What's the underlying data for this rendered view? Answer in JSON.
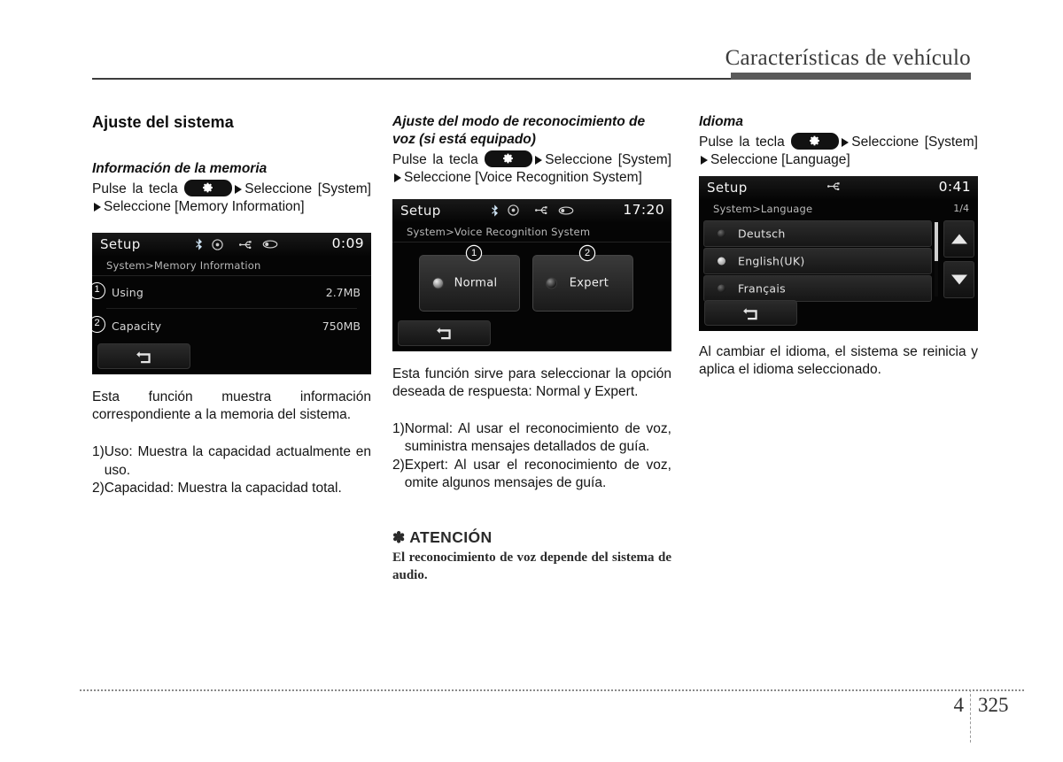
{
  "header": {
    "title": "Características de vehículo"
  },
  "footer": {
    "chapter": "4",
    "page": "325"
  },
  "column1": {
    "section_title": "Ajuste del sistema",
    "sub_title": "Información de la memoria",
    "instruction_pre": "Pulse la tecla",
    "instruction_post": "Seleccione [System]",
    "instruction_post2": "Seleccione [Memory Information]",
    "screen": {
      "title": "Setup",
      "clock": "0:09",
      "breadcrumb": "System>Memory Information",
      "status_icons": [
        "bluetooth-icon",
        "disc-icon",
        "usb-icon",
        "ipod-icon"
      ],
      "rows": [
        {
          "callout": "1",
          "label": "Using",
          "value": "2.7MB"
        },
        {
          "callout": "2",
          "label": "Capacity",
          "value": "750MB"
        }
      ],
      "back_button": "back-icon"
    },
    "description": "Esta función muestra información correspondiente a la memoria del sistema.",
    "list": [
      {
        "marker": "1)",
        "text": "Uso: Muestra la capacidad actualmente en uso."
      },
      {
        "marker": "2)",
        "text": "Capacidad: Muestra la capacidad total."
      }
    ]
  },
  "column2": {
    "sub_title": "Ajuste del modo de reconocimiento de voz (si está equipado)",
    "instruction_pre": "Pulse la tecla",
    "instruction_post": "Seleccione [System]",
    "instruction_post2": "Seleccione [Voice Recognition System]",
    "screen": {
      "title": "Setup",
      "clock": "17:20",
      "breadcrumb": "System>Voice Recognition System",
      "status_icons": [
        "bluetooth-icon",
        "disc-icon",
        "usb-icon",
        "ipod-icon"
      ],
      "options": [
        {
          "callout": "1",
          "label": "Normal",
          "selected": true
        },
        {
          "callout": "2",
          "label": "Expert",
          "selected": false
        }
      ],
      "back_button": "back-icon"
    },
    "description": "Esta función sirve para seleccionar la opción deseada de respuesta: Normal y Expert.",
    "list": [
      {
        "marker": "1)",
        "text": "Normal: Al usar el reconocimiento de voz, suministra mensajes detallados de guía."
      },
      {
        "marker": "2)",
        "text": "Expert: Al usar el reconocimiento de voz, omite algunos mensajes de guía."
      }
    ],
    "caution": {
      "asterisk": "✽",
      "heading": "ATENCIÓN",
      "body": "El reconocimiento de voz depende del sistema de audio."
    }
  },
  "column3": {
    "sub_title": "Idioma",
    "instruction_pre": "Pulse la tecla",
    "instruction_post": "Seleccione [System]",
    "instruction_post2": "Seleccione [Language]",
    "screen": {
      "title": "Setup",
      "clock": "0:41",
      "breadcrumb": "System>Language",
      "page_indicator": "1/4",
      "status_icons": [
        "usb-icon"
      ],
      "languages": [
        {
          "label": "Deutsch",
          "selected": false
        },
        {
          "label": "English(UK)",
          "selected": true
        },
        {
          "label": "Français",
          "selected": false
        }
      ],
      "scroll_up": "triangle-up-icon",
      "scroll_down": "triangle-down-icon",
      "back_button": "back-icon"
    },
    "description": "Al cambiar el idioma, el sistema se reinicia y aplica el idioma seleccionado."
  },
  "colors": {
    "header_rule": "#3c3c3c",
    "header_bar": "#5a5a5a",
    "screen_bg": "#050505"
  }
}
